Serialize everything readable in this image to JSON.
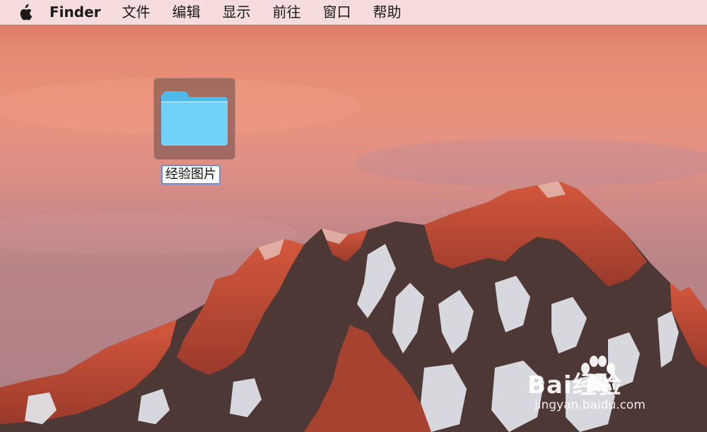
{
  "menubar": {
    "apple_icon": "apple-logo-icon",
    "app_name": "Finder",
    "items": [
      "文件",
      "编辑",
      "显示",
      "前往",
      "窗口",
      "帮助"
    ]
  },
  "desktop": {
    "folder": {
      "icon": "folder-icon",
      "name": "经验图片",
      "selected": true,
      "color": "#6ccff5"
    }
  },
  "watermark": {
    "brand": "Bai经验",
    "url": "jingyan.baidu.com"
  },
  "colors": {
    "sky_top": "#d96f5c",
    "sky_mid": "#e69282",
    "mountain_lit": "#c4513a",
    "mountain_shadow": "#4a3634",
    "snow": "#dfe3ea"
  }
}
